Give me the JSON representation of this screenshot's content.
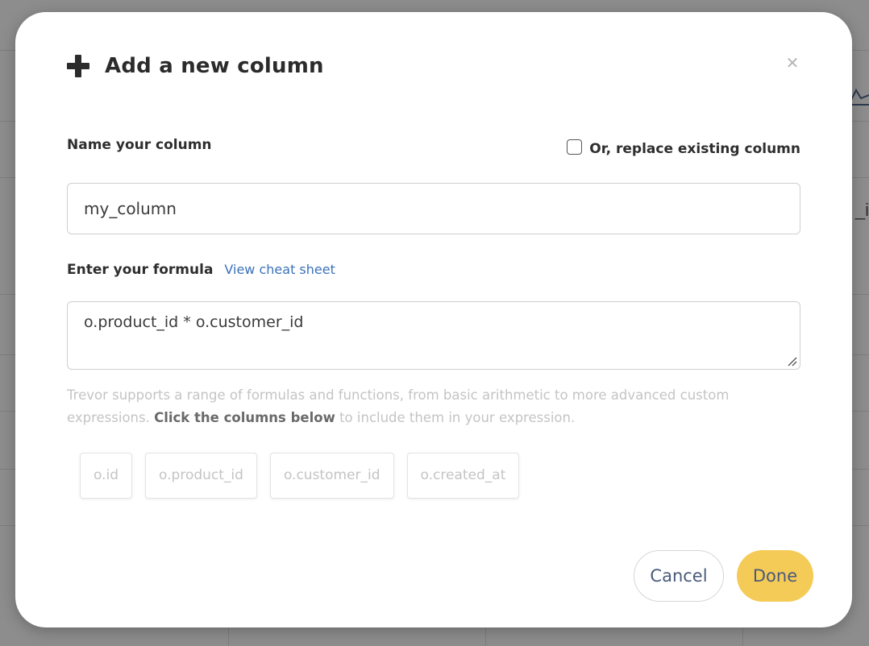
{
  "modal": {
    "title": "Add a new column",
    "icon": "plus-icon",
    "close_icon": "close-icon"
  },
  "name_section": {
    "label": "Name your column",
    "replace_label": "Or, replace existing column",
    "replace_checked": false,
    "input_value": "my_column"
  },
  "formula_section": {
    "label": "Enter your formula",
    "cheat_sheet_link": "View cheat sheet",
    "input_value": "o.product_id * o.customer_id",
    "help_text_before": "Trevor supports a range of formulas and functions, from basic arithmetic to more advanced custom expressions. ",
    "help_text_bold": "Click the columns below",
    "help_text_after": " to include them in your expression."
  },
  "columns": [
    {
      "label": "o.id"
    },
    {
      "label": "o.product_id"
    },
    {
      "label": "o.customer_id"
    },
    {
      "label": "o.created_at"
    }
  ],
  "footer": {
    "cancel_label": "Cancel",
    "done_label": "Done"
  },
  "colors": {
    "accent": "#f5cb57",
    "link": "#3b72b8",
    "backdrop": "#8d8d8d"
  },
  "background": {
    "peek_text_1": "_i",
    "peek_icon": "line-chart-icon"
  }
}
